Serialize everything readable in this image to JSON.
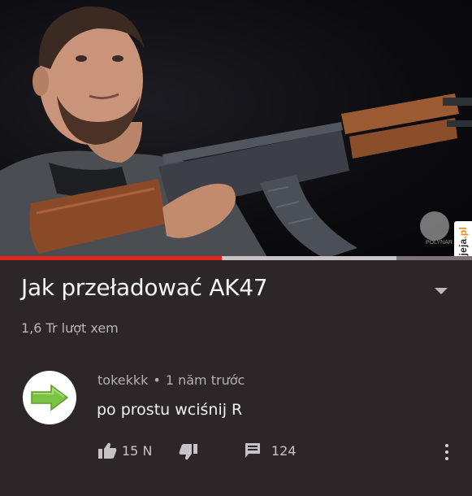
{
  "video": {
    "title": "Jak przeładować AK47",
    "views": "1,6 Tr lượt xem",
    "progress_fraction": 0.47,
    "buffered_fraction": 0.84,
    "watermark": "jeja.pl"
  },
  "comment": {
    "author": "tokekkk",
    "separator": "•",
    "time": "1 năm trước",
    "text": "po prostu wciśnij R",
    "like_count": "15 N",
    "reply_count": "124"
  },
  "colors": {
    "background": "#2c2629",
    "progress": "#e0241e",
    "avatar_arrow": "#7cc243"
  },
  "icons": [
    "expand-chevron-icon",
    "right-arrow-icon",
    "thumbs-up-icon",
    "thumbs-down-icon",
    "reply-icon",
    "more-vert-icon"
  ]
}
